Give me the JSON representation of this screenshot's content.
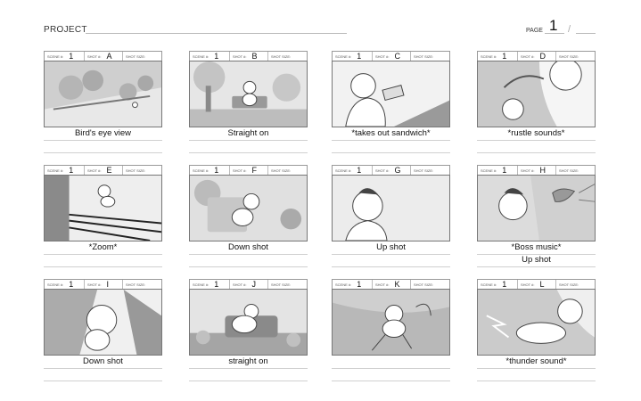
{
  "header": {
    "project_label": "PROJECT",
    "page_label": "PAGE",
    "page_number": "1",
    "page_separator": "/"
  },
  "field_labels": {
    "scene": "SCENE #:",
    "shot": "SHOT #:",
    "shot_size": "SHOT SIZE:"
  },
  "panels": [
    {
      "scene": "1",
      "shot": "A",
      "caption": "Bird's eye view",
      "caption2": ""
    },
    {
      "scene": "1",
      "shot": "B",
      "caption": "Straight on",
      "caption2": ""
    },
    {
      "scene": "1",
      "shot": "C",
      "caption": "*takes out sandwich*",
      "caption2": ""
    },
    {
      "scene": "1",
      "shot": "D",
      "caption": "*rustle sounds*",
      "caption2": ""
    },
    {
      "scene": "1",
      "shot": "E",
      "caption": "*Zoom*",
      "caption2": ""
    },
    {
      "scene": "1",
      "shot": "F",
      "caption": "Down shot",
      "caption2": ""
    },
    {
      "scene": "1",
      "shot": "G",
      "caption": "Up shot",
      "caption2": ""
    },
    {
      "scene": "1",
      "shot": "H",
      "caption": "*Boss music*",
      "caption2": "Up shot"
    },
    {
      "scene": "1",
      "shot": "I",
      "caption": "Down shot",
      "caption2": ""
    },
    {
      "scene": "1",
      "shot": "J",
      "caption": "straight on",
      "caption2": ""
    },
    {
      "scene": "1",
      "shot": "K",
      "caption": "",
      "caption2": ""
    },
    {
      "scene": "1",
      "shot": "L",
      "caption": "*thunder sound*",
      "caption2": ""
    }
  ]
}
